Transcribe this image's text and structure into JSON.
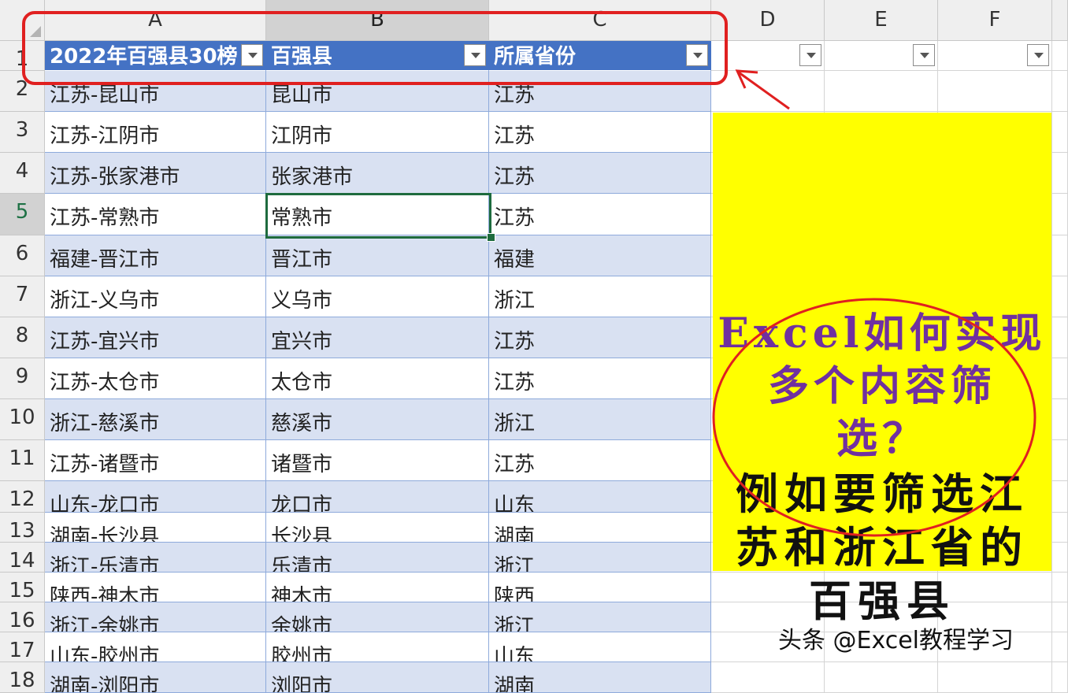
{
  "sheet": {
    "column_headers": [
      "A",
      "B",
      "C",
      "D",
      "E",
      "F"
    ],
    "row_numbers": [
      "1",
      "2",
      "3",
      "4",
      "5",
      "6",
      "7",
      "8",
      "9",
      "10",
      "11",
      "12",
      "13",
      "14",
      "15",
      "16",
      "17",
      "18"
    ],
    "table_headers": [
      "2022年百强县30榜",
      "百强县",
      "所属省份"
    ],
    "rows": [
      [
        "江苏-昆山市",
        "昆山市",
        "江苏"
      ],
      [
        "江苏-江阴市",
        "江阴市",
        "江苏"
      ],
      [
        "江苏-张家港市",
        "张家港市",
        "江苏"
      ],
      [
        "江苏-常熟市",
        "常熟市",
        "江苏"
      ],
      [
        "福建-晋江市",
        "晋江市",
        "福建"
      ],
      [
        "浙江-义乌市",
        "义乌市",
        "浙江"
      ],
      [
        "江苏-宜兴市",
        "宜兴市",
        "江苏"
      ],
      [
        "江苏-太仓市",
        "太仓市",
        "江苏"
      ],
      [
        "浙江-慈溪市",
        "慈溪市",
        "浙江"
      ],
      [
        "江苏-诸暨市",
        "诸暨市",
        "江苏"
      ],
      [
        "山东-龙口市",
        "龙口市",
        "山东"
      ],
      [
        "湖南-长沙县",
        "长沙县",
        "湖南"
      ],
      [
        "浙江-乐清市",
        "乐清市",
        "浙江"
      ],
      [
        "陕西-神木市",
        "神木市",
        "陕西"
      ],
      [
        "浙江-余姚市",
        "余姚市",
        "浙江"
      ],
      [
        "山东-胶州市",
        "胶州市",
        "山东"
      ],
      [
        "湖南-浏阳市",
        "浏阳市",
        "湖南"
      ]
    ],
    "selected_cell": "B5"
  },
  "note": {
    "question_lines": [
      "Excel如何实现",
      "多个内容筛",
      "选？"
    ],
    "answer_lines": [
      "例如要筛选江",
      "苏和浙江省的",
      "百强县"
    ]
  },
  "colors": {
    "header_fill": "#4472c4",
    "band_fill": "#d9e1f2",
    "note_fill": "#ffff00",
    "question_text": "#7030a0",
    "annotation_red": "#e02020",
    "selection_green": "#1e6b3e"
  },
  "watermark": "头条 @Excel教程学习"
}
